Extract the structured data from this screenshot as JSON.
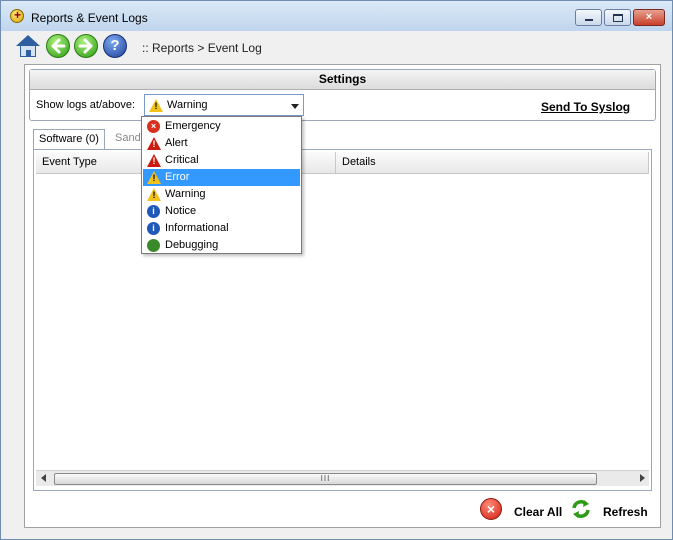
{
  "window": {
    "title": "Reports & Event Logs",
    "close_glyph": "×"
  },
  "toolbar": {
    "breadcrumb": ":: Reports > Event Log"
  },
  "settings": {
    "header": "Settings",
    "show_logs_label": "Show logs at/above:",
    "selected_level": "Warning",
    "send_to_syslog": "Send To Syslog"
  },
  "tabs": [
    {
      "label": "Software (0)",
      "active": true
    },
    {
      "label": "Sandbox",
      "active": false
    }
  ],
  "table": {
    "columns": [
      "Event Type",
      "Details"
    ],
    "rows": []
  },
  "scrollbar": {
    "grip": "III"
  },
  "dropdown": {
    "options": [
      {
        "label": "Emergency",
        "icon": "emergency-icon"
      },
      {
        "label": "Alert",
        "icon": "alert-icon"
      },
      {
        "label": "Critical",
        "icon": "critical-icon"
      },
      {
        "label": "Error",
        "icon": "error-icon",
        "highlighted": true
      },
      {
        "label": "Warning",
        "icon": "warning-icon"
      },
      {
        "label": "Notice",
        "icon": "notice-icon"
      },
      {
        "label": "Informational",
        "icon": "informational-icon"
      },
      {
        "label": "Debugging",
        "icon": "debugging-icon"
      }
    ]
  },
  "footer": {
    "clear_all": "Clear All",
    "refresh": "Refresh"
  },
  "colors": {
    "highlight": "#3399ff",
    "error_red": "#d8301e",
    "warning_yellow": "#f2c21a",
    "info_blue": "#1f58b8",
    "success_green": "#2e9a16"
  }
}
